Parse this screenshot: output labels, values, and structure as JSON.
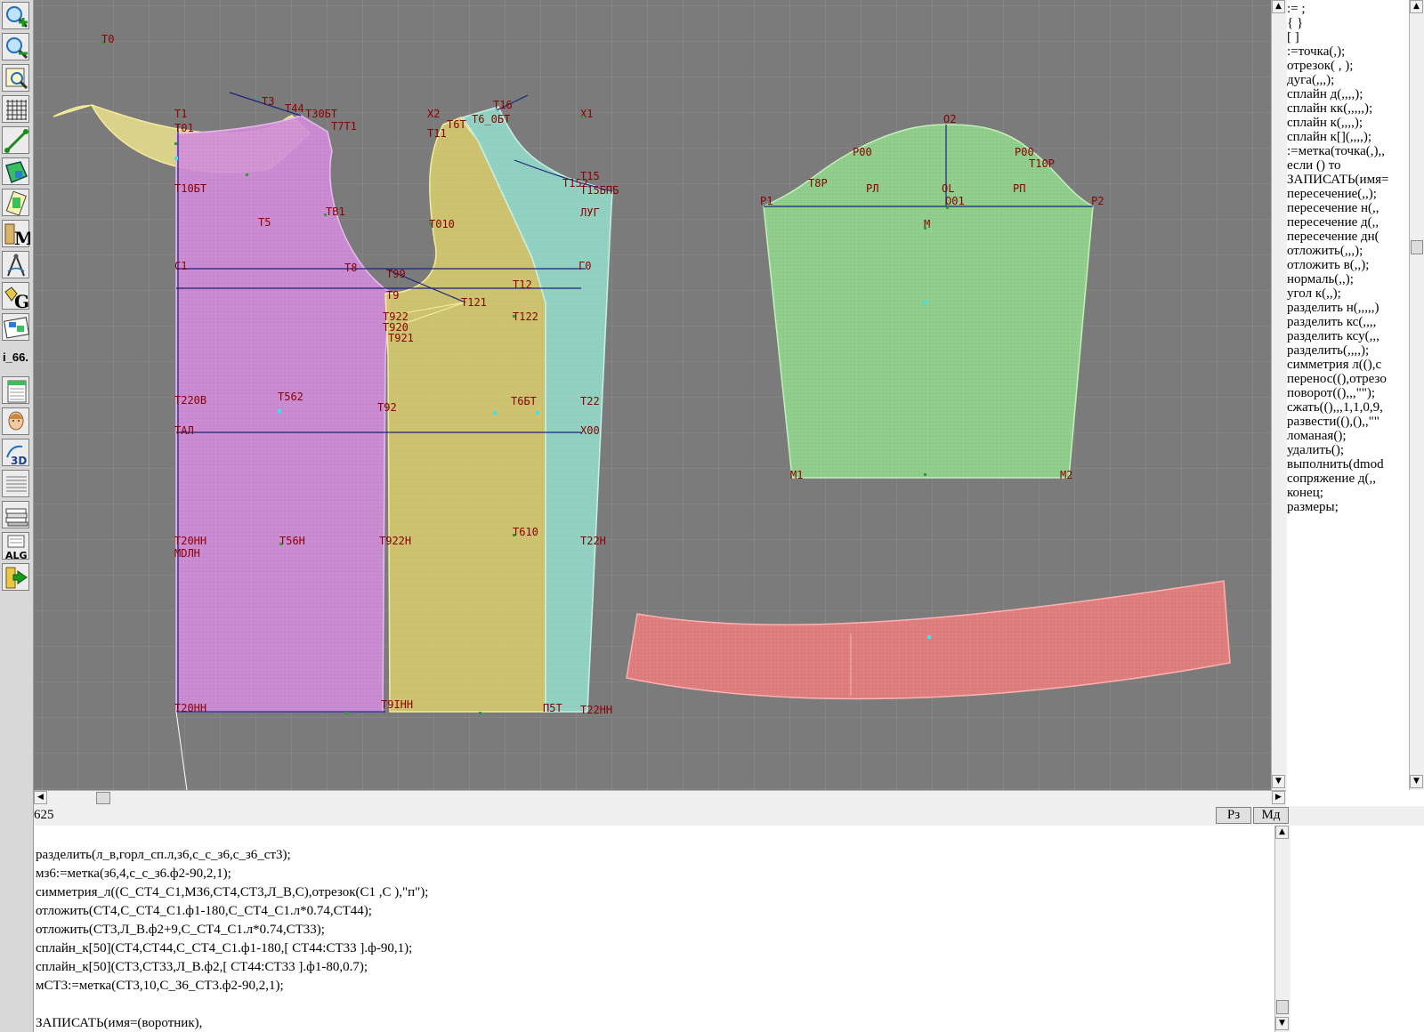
{
  "toolbar": {
    "label_text": "i_66."
  },
  "drawing": {
    "point_labels": {
      "t0": "T0",
      "t1": "T1",
      "t01": "T01",
      "t3": "T3",
      "t44": "T44",
      "t30bt": "T30БТ",
      "t7t1": "T7T1",
      "t10bt": "T10БТ",
      "t5": "T5",
      "tb1": "TB1",
      "c1": "C1",
      "t8": "T8",
      "t99": "T99",
      "t9": "T9",
      "g0": "Г0",
      "t12": "T12",
      "t121": "T121",
      "t122": "T122",
      "t922": "T922",
      "t920": "T920",
      "t921": "T921",
      "t220b": "T220B",
      "t562": "T562",
      "t92": "T92",
      "t6bt": "T6БТ",
      "t22": "T22",
      "tal": "TАЛ",
      "x00": "X00",
      "t20hh": "T20HH",
      "mdlh": "MDЛH",
      "t56h": "T56H",
      "t922h": "T922H",
      "t610": "T610",
      "t22h": "T22H",
      "t20hh2": "T20HH",
      "t9ih": "T9IHH",
      "p5t": "П5T",
      "t22hh": "T22HH",
      "x2": "X2",
      "t11": "T11",
      "t6t": "T6T",
      "t16": "T16",
      "t6_0bt": "T6_0БТ",
      "x1": "X1",
      "t15": "T15",
      "t152": "T152",
      "t15b": "T15БПБ",
      "lug": "ЛУГ",
      "t010": "T010",
      "o2": "O2",
      "r00": "P00",
      "r00r": "P00",
      "t10r": "T10P",
      "t8r": "T8P",
      "rl": "PЛ",
      "ol": "OL",
      "rp": "PП",
      "p1": "P1",
      "p2": "P2",
      "o01": "O01",
      "m": "M",
      "m1": "M1",
      "m2": "M2"
    }
  },
  "command_list": [
    ":= ;",
    "{ }",
    "[ ]",
    ":=точка(,);",
    "отрезок( , );",
    "дуга(,,,);",
    "сплайн  д(,,,,);",
    "сплайн  кк(,,,,,);",
    "сплайн  к(,,,,);",
    "сплайн  к[](,,,,);",
    ":=метка(точка(,),,",
    "если () то",
    "ЗАПИСАТЬ(имя=",
    "пересечение(,,);",
    "пересечение  н(,,",
    "пересечение  д(,,",
    "пересечение  дн(",
    "отложить(,,,);",
    "отложить  в(,,);",
    "нормаль(,,);",
    "угол  к(,,);",
    "разделить  н(,,,,,)",
    "разделить  кс(,,,,",
    "разделить  ксу(,,,",
    "разделить(,,,,);",
    "симметрия  л((),с",
    "перенос((),отрезо",
    "поворот((),,,\"\");",
    "сжать((),,,1,1,0,9,",
    "развести((),(),,\"\"",
    "ломаная();",
    "удалить();",
    "выполнить(dmod",
    "сопряжение  д(,,",
    "конец;",
    "размеры;"
  ],
  "status": {
    "value": "625",
    "rz_label": "Рз",
    "md_label": "Мд"
  },
  "editor": {
    "lines": [
      "",
      "разделить(л_в,горл_сп.л,з6,с_с_з6,с_з6_ст3);",
      "мз6:=метка(з6,4,с_с_з6.ф2-90,2,1);",
      "симметрия_л((С_СТ4_С1,МЗ6,СТ4,СТ3,Л_В,С),отрезок(С1 ,С ),\"п\");",
      "отложить(СТ4,С_СТ4_С1.ф1-180,С_СТ4_С1.л*0.74,СТ44);",
      "отложить(СТ3,Л_В.ф2+9,С_СТ4_С1.л*0.74,СТ33);",
      "сплайн_к[50](СТ4,СТ44,С_СТ4_С1.ф1-180,[ СТ44:СТ33 ].ф-90,1);",
      "сплайн_к[50](СТ3,СТ33,Л_В.ф2,[ СТ44:СТ33 ].ф1-80,0.7);",
      "мСТ3:=метка(СТ3,10,С_З6_СТ3.ф2-90,2,1);",
      "",
      "ЗАПИСАТЬ(имя=(воротник),"
    ]
  }
}
